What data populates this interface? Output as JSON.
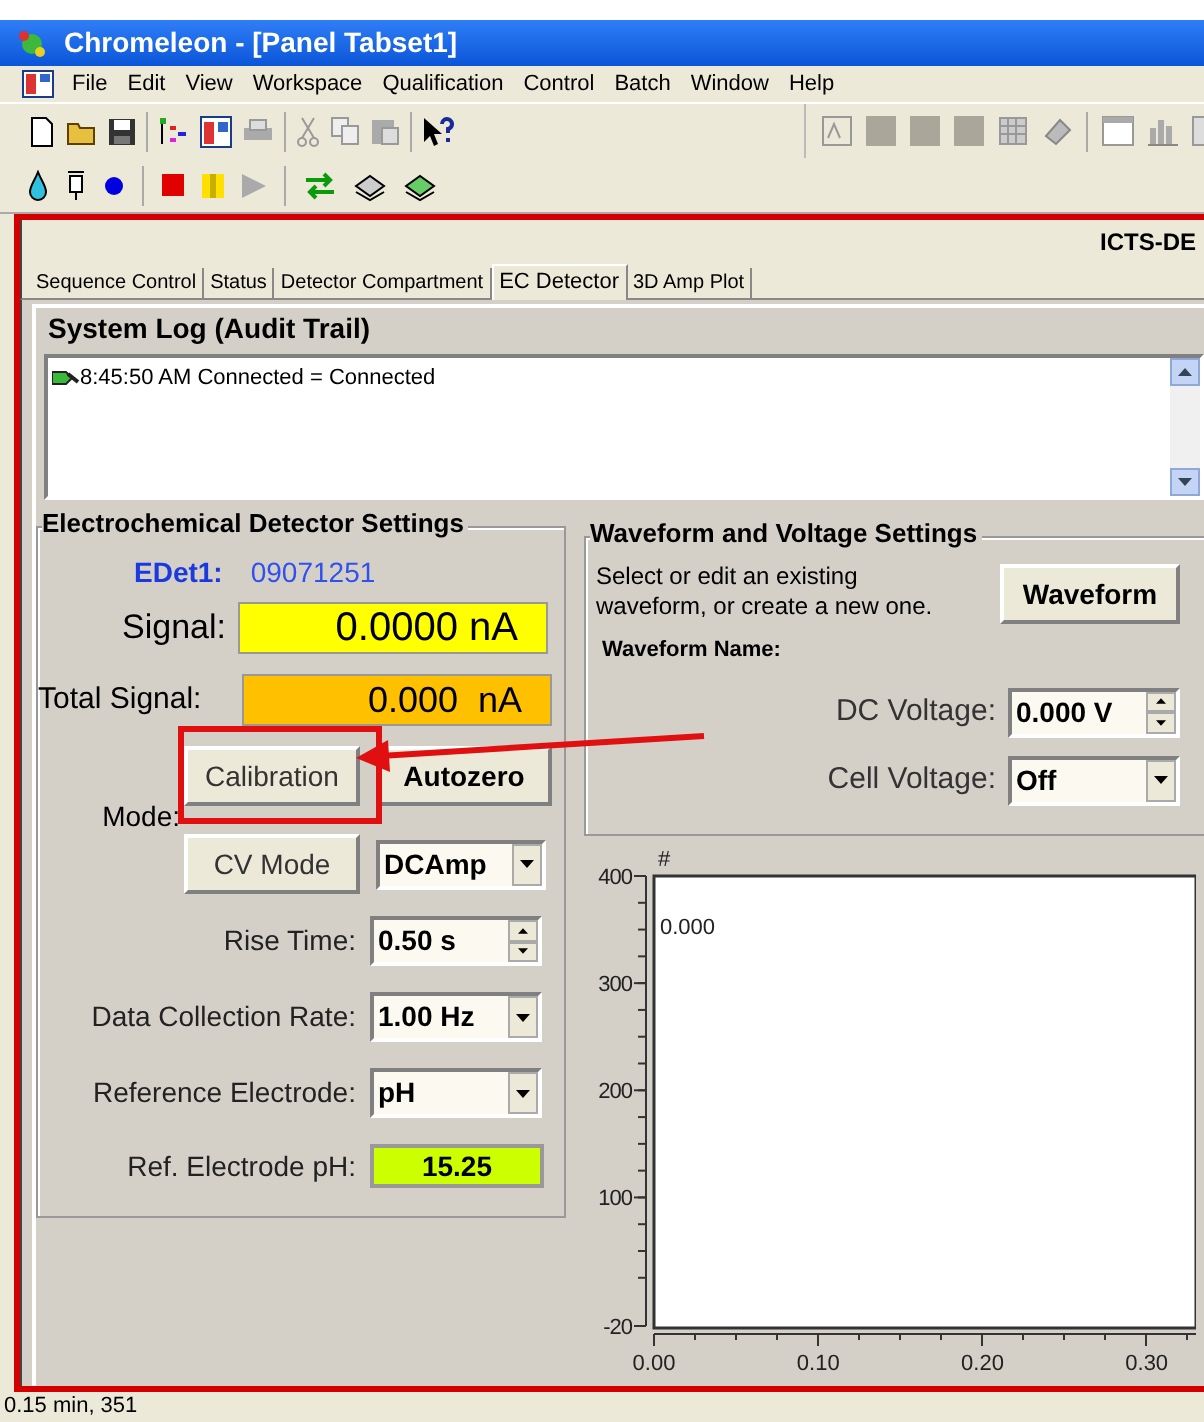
{
  "window": {
    "title": "Chromeleon - [Panel Tabset1]"
  },
  "menu": [
    "File",
    "Edit",
    "View",
    "Workspace",
    "Qualification",
    "Control",
    "Batch",
    "Window",
    "Help"
  ],
  "panel_header": "ICTS-DE",
  "tabs": [
    {
      "label": "Sequence Control",
      "selected": false
    },
    {
      "label": "Status",
      "selected": false
    },
    {
      "label": "Detector Compartment",
      "selected": false
    },
    {
      "label": "EC Detector",
      "selected": true
    },
    {
      "label": "3D Amp Plot",
      "selected": false
    }
  ],
  "system_log": {
    "title": "System Log (Audit Trail)",
    "entries": [
      "8:45:50 AM Connected = Connected"
    ]
  },
  "detector_settings": {
    "title": "Electrochemical Detector Settings",
    "device_label": "EDet1:",
    "device_serial": "09071251",
    "signal": {
      "label": "Signal:",
      "value": "0.0000 nA"
    },
    "total_signal": {
      "label": "Total Signal:",
      "value": "0.000  nA"
    },
    "mode": {
      "label": "Mode:",
      "buttons": [
        "Calibration",
        "Autozero",
        "CV Mode"
      ],
      "select": "DCAmp"
    },
    "fields": [
      {
        "kind": "spinner",
        "label": "Rise Time:",
        "value": "0.50 s"
      },
      {
        "kind": "dropdown",
        "label": "Data Collection Rate:",
        "value": "1.00 Hz"
      },
      {
        "kind": "dropdown",
        "label": "Reference Electrode:",
        "value": "pH"
      },
      {
        "kind": "readout",
        "label": "Ref. Electrode pH:",
        "value": "15.25"
      }
    ]
  },
  "waveform_settings": {
    "title": "Waveform and Voltage Settings",
    "description": "Select or edit an existing waveform, or create a new one.",
    "button": "Waveform",
    "name_label": "Waveform Name:",
    "fields": [
      {
        "kind": "spinner",
        "label": "DC Voltage:",
        "value": "0.000 V"
      },
      {
        "kind": "dropdown",
        "label": "Cell Voltage:",
        "value": "Off"
      }
    ]
  },
  "chart": {
    "chart_data": {
      "type": "line",
      "ylabel": "#",
      "xlim": [
        0,
        0.33
      ],
      "ylim": [
        -20,
        400
      ],
      "xticks": [
        {
          "value": 0,
          "label": "0.00"
        },
        {
          "value": 0.1,
          "label": "0.10"
        },
        {
          "value": 0.2,
          "label": "0.20"
        },
        {
          "value": 0.3,
          "label": "0.30"
        }
      ],
      "yticks": [
        400,
        300,
        200,
        100,
        -20
      ],
      "annotations": [
        "0.000"
      ]
    }
  },
  "status_bar": "0.15 min, 351"
}
